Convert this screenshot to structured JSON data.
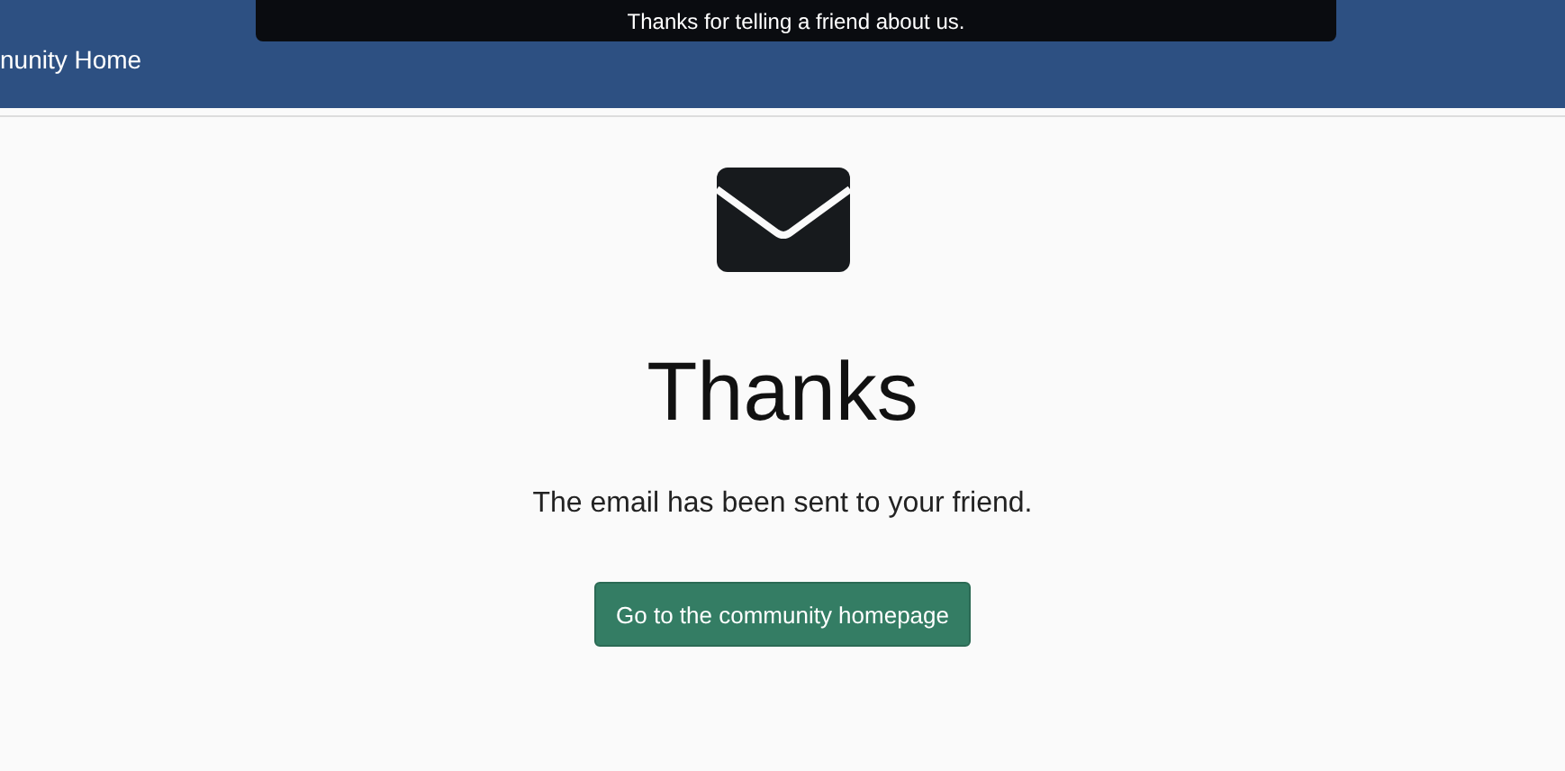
{
  "toast": {
    "message": "Thanks for telling a friend about us."
  },
  "nav": {
    "link": "nunity Home"
  },
  "confirmation": {
    "title": "Thanks",
    "message": "The email has been sent to your friend.",
    "button": "Go to the community homepage"
  }
}
